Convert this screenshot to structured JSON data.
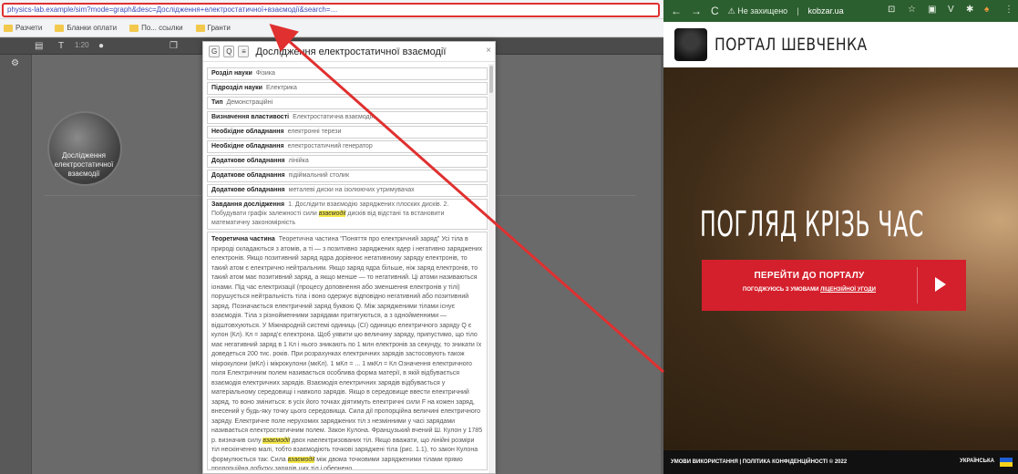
{
  "left": {
    "url": "physics-lab.example/sim?mode=graph&desc=Дослідження+електростатичної+взаємодії&search=…",
    "bookmarks": [
      "Разчети",
      "Бланки оплати",
      "По... ссылки",
      "Гранти"
    ],
    "toolbar": {
      "t_label": "T",
      "zoom": "1:20"
    },
    "node_label": "Дослідження електростатичної взаємодії",
    "dialog": {
      "btn_g": "G",
      "btn_q": "Q",
      "btn_list": "≡",
      "title": "Дослідження електростатичної взаємодії",
      "close": "×",
      "rows": [
        {
          "label": "Розділ науки",
          "value": "Фізика"
        },
        {
          "label": "Підрозділ науки",
          "value": "Електрика"
        },
        {
          "label": "Тип",
          "value": "Демонстраційні"
        },
        {
          "label": "Визначення властивості",
          "value": "Електростатична взаємодія"
        },
        {
          "label": "Необхідне обладнання",
          "value": "електронні терези"
        },
        {
          "label": "Необхідне обладнання",
          "value": "електростатичний генератор"
        },
        {
          "label": "Додаткове обладнання",
          "value": "лінійка"
        },
        {
          "label": "Додаткове обладнання",
          "value": "підіймальний столик"
        },
        {
          "label": "Додаткове обладнання",
          "value": "металеві диски на ізолюючих утримувачах"
        }
      ],
      "task_label": "Завдання дослідження",
      "task_pre": "1. Дослідити взаємодію заряджених плоских дисків. 2. Побудувати графік залежності сили ",
      "task_hl": "взаємодії",
      "task_post": " дисків від відстані та встановити математичну закономірність",
      "theory_label": "Теоретична частина",
      "theory_text": "Теоретична частина \"Поняття про електричний заряд\" Усі тіла в природі складаються з атомів, а ті — з позитивно заряджених ядер і негативно заряджених електронів. Якщо позитивний заряд ядра дорівнює негативному заряду електронів, то такий атом є електрично нейтральним. Якщо заряд ядра більше, ніж заряд електронів, то такий атом має позитивний заряд, а якщо менше — то негативний. Ці атоми називаються іонами. Під час електризації (процесу доповнення або зменшення електронів у тілі) порушується нейтральність тіла і воно одержує відповідно негативний або позитивний заряд. Позначається електричний заряд буквою Q. Між зарядженими тілами існує взаємодія. Тіла з різнойменними зарядами притягуються, а з однойменними — відштовхуються. У Міжнародній системі одиниць (СІ) одиницю електричного заряду Q є кулон (Кл). Кл = заряд'є електрона. Щоб уявити цю величину заряду, припустимо, що тіло має негативний заряд в 1 Кл і нього зникають по 1 млн електронів за секунду, то зникати їх доведеться 200 тис. років. При розрахунках електричних зарядів застосовують також мікрокулони (мКл) і мікрокулони (мкКл). 1 мКл = ... 1 мкКл = Кл Означення електричного поля Електричним полем називається особлива форма матерії, в якій відбувається взаємодія електричних зарядів. Взаємодія електричних зарядів відбувається у матеріальному середовищі і навколо зарядів. Якщо в середовище ввести електричний заряд, то воно зміниться: в усіх його точках діятимуть електричні сили F на кожен заряд, внесений у будь-яку точку цього середовища. Сила дії пропорційна величині електричного заряду. Електричне поле нерухомих заряджених тіл з незмінними у часі зарядами називається електростатичним полем. Закон Кулона. Французький вчений Ш. Кулон у 1785 р. визначив силу ",
      "theory_hl1": "взаємодії",
      "theory_mid": " двох наелектризованих тіл. Якщо вважати, що лінійні розміри тіл нескінченно малі, тобто взаємодіють точкові заряджені тіла (рис. 1.1), то закон Кулона формулюється так: Сила ",
      "theory_hl2": "взаємодії",
      "theory_post": " між двома точковими зарядженими тілами прямо пропорційна добутку зарядів цих тіл і обернено"
    }
  },
  "right": {
    "browser": {
      "back": "←",
      "forward": "→",
      "reload": "C",
      "warning": "⚠ Не захищено",
      "domain": "kobzar.ua",
      "ext_icons": [
        "⊡",
        "☆",
        "▣",
        "V",
        "✱",
        "♠",
        "⋮"
      ]
    },
    "site": {
      "name": "ПОРТАЛ ШЕВЧЕНКА",
      "hero_title": "ПОГЛЯД КРІЗЬ ЧАС",
      "cta_main": "ПЕРЕЙТИ ДО ПОРТАЛУ",
      "cta_sub_pre": "ПОГОДЖУЮСЬ З УМОВАМИ ",
      "cta_sub_link": "ЛІЦЕНЗІЙНОЇ УГОДИ",
      "footer_text": "УМОВИ ВИКОРИСТАННЯ | ПОЛІТИКА КОНФІДЕНЦІЙНОСТІ © 2022",
      "language": "УКРАЇНСЬКА"
    }
  },
  "colors": {
    "annotation_red": "#e03030",
    "cta_red": "#d4202c",
    "chrome_green": "#2c5f2f",
    "highlight": "#f5e84a"
  }
}
